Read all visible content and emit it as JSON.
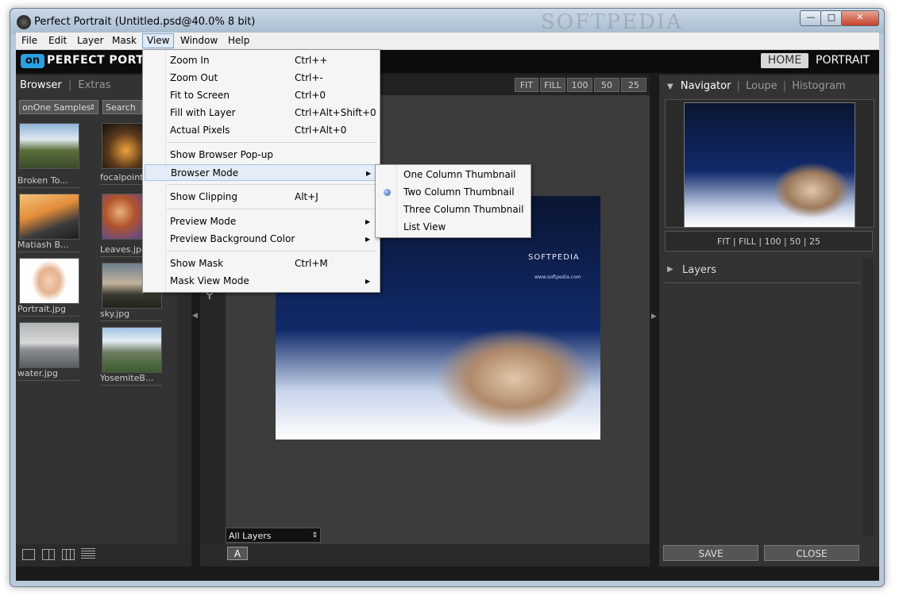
{
  "window": {
    "title": "Perfect Portrait (Untitled.psd@40.0% 8 bit)",
    "watermark": "SOFTPEDIA",
    "controls": {
      "minimize": "—",
      "maximize": "□",
      "close": "✕"
    }
  },
  "menubar": {
    "items": [
      "File",
      "Edit",
      "Layer",
      "Mask",
      "View",
      "Window",
      "Help"
    ],
    "active": "View"
  },
  "header": {
    "logo_mark": "on",
    "logo_text": "PERFECT PORTR",
    "home": "HOME",
    "portrait": "PORTRAIT"
  },
  "left_panel": {
    "tab_active": "Browser",
    "tab_other": "Extras",
    "source": "onOne Samples",
    "search_placeholder": "Search",
    "thumbnails": [
      {
        "label": "Broken To...",
        "icon": "mountain-lake-photo"
      },
      {
        "label": "focalpoint...",
        "icon": "city-night-photo"
      },
      {
        "label": "Matiash B...",
        "icon": "bridge-photo"
      },
      {
        "label": "Leaves.jpg",
        "icon": "leaves-photo"
      },
      {
        "label": "Portrait.jpg",
        "icon": "portrait-photo"
      },
      {
        "label": "sky.jpg",
        "icon": "sky-photo"
      },
      {
        "label": "water.jpg",
        "icon": "water-photo"
      },
      {
        "label": "YosemiteB...",
        "icon": "yosemite-photo"
      }
    ]
  },
  "zoom_buttons": [
    "FIT",
    "FILL",
    "100",
    "50",
    "25"
  ],
  "canvas": {
    "photo_logo": "SOFTPEDIA",
    "photo_url": "www.softpedia.com",
    "layers_select": "All Layers",
    "mask_button": "A"
  },
  "right_panel": {
    "tab_active": "Navigator",
    "tab_loupe": "Loupe",
    "tab_histogram": "Histogram",
    "nav_zoom": "FIT | FILL | 100 | 50 | 25",
    "layers_title": "Layers",
    "save": "SAVE",
    "close": "CLOSE"
  },
  "view_menu": {
    "items": [
      {
        "label": "Zoom In",
        "shortcut": "Ctrl++"
      },
      {
        "label": "Zoom Out",
        "shortcut": "Ctrl+-"
      },
      {
        "label": "Fit to Screen",
        "shortcut": "Ctrl+0"
      },
      {
        "label": "Fill with Layer",
        "shortcut": "Ctrl+Alt+Shift+0"
      },
      {
        "label": "Actual Pixels",
        "shortcut": "Ctrl+Alt+0"
      },
      {
        "label": "Show Browser Pop-up",
        "shortcut": ""
      },
      {
        "label": "Browser Mode",
        "shortcut": ""
      },
      {
        "label": "Show Clipping",
        "shortcut": "Alt+J"
      },
      {
        "label": "Preview Mode",
        "shortcut": ""
      },
      {
        "label": "Preview Background Color",
        "shortcut": ""
      },
      {
        "label": "Show Mask",
        "shortcut": "Ctrl+M"
      },
      {
        "label": "Mask View Mode",
        "shortcut": ""
      }
    ]
  },
  "browser_submenu": {
    "items": [
      "One Column Thumbnail",
      "Two Column Thumbnail",
      "Three Column Thumbnail",
      "List View"
    ],
    "selected": "Two Column Thumbnail"
  }
}
